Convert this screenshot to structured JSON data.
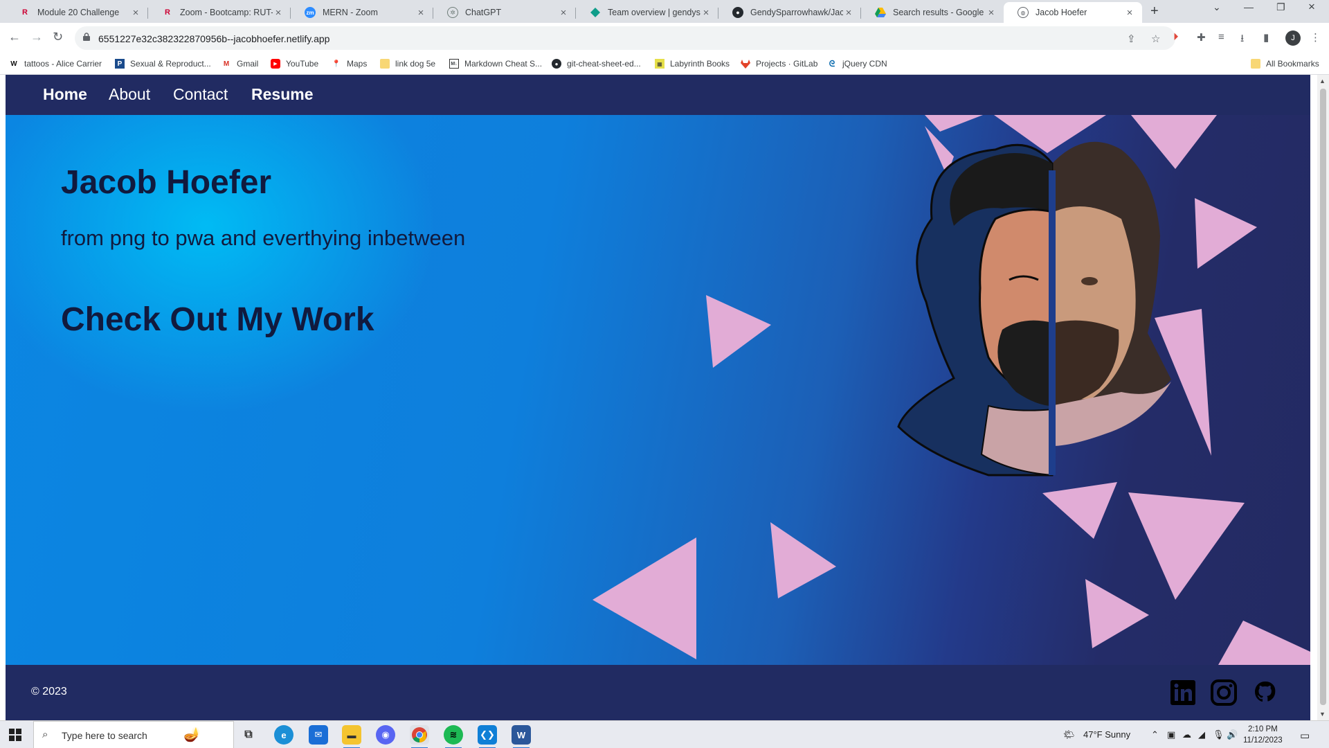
{
  "browser": {
    "tabs": [
      {
        "title": "Module 20 Challenge",
        "icon": "rutgers-r-icon"
      },
      {
        "title": "Zoom - Bootcamp: RUT-V",
        "icon": "rutgers-r-icon"
      },
      {
        "title": "MERN - Zoom",
        "icon": "zoom-icon"
      },
      {
        "title": "ChatGPT",
        "icon": "chatgpt-icon"
      },
      {
        "title": "Team overview | gendysp",
        "icon": "diamond-icon"
      },
      {
        "title": "GendySparrowhawk/Jacol",
        "icon": "github-icon"
      },
      {
        "title": "Search results - Google D",
        "icon": "google-drive-icon"
      },
      {
        "title": "Jacob Hoefer",
        "icon": "globe-icon",
        "active": true
      }
    ],
    "url": "6551227e32c382322870956b--jacobhoefer.netlify.app",
    "profile_initial": "J",
    "bookmarks": [
      {
        "label": "tattoos - Alice Carrier",
        "icon": "w-icon"
      },
      {
        "label": "Sexual & Reproduct...",
        "icon": "page-icon"
      },
      {
        "label": "Gmail",
        "icon": "gmail-icon"
      },
      {
        "label": "YouTube",
        "icon": "youtube-icon"
      },
      {
        "label": "Maps",
        "icon": "maps-icon"
      },
      {
        "label": "link dog 5e",
        "icon": "folder-icon"
      },
      {
        "label": "Markdown Cheat S...",
        "icon": "markdown-icon"
      },
      {
        "label": "git-cheat-sheet-ed...",
        "icon": "github-icon"
      },
      {
        "label": "Labyrinth Books",
        "icon": "labyrinth-icon"
      },
      {
        "label": "Projects · GitLab",
        "icon": "gitlab-icon"
      },
      {
        "label": "jQuery CDN",
        "icon": "jquery-icon"
      }
    ],
    "all_bookmarks": "All Bookmarks"
  },
  "site": {
    "nav": [
      "Home",
      "About",
      "Contact",
      "Resume"
    ],
    "hero": {
      "name": "Jacob Hoefer",
      "tagline": "from png to pwa and everthying inbetween",
      "cta": "Check Out My Work"
    },
    "footer": {
      "copyright": "© 2023",
      "social": [
        "linkedin-icon",
        "instagram-icon",
        "github-icon"
      ]
    },
    "colors": {
      "nav_bg": "#212b62",
      "hero_text": "#111a3e",
      "triangle": "#e2acd6"
    }
  },
  "taskbar": {
    "search_placeholder": "Type here to search",
    "weather": "47°F  Sunny",
    "time": "2:10 PM",
    "date": "11/12/2023",
    "apps": [
      "task-view-icon",
      "edge-icon",
      "mail-icon",
      "file-explorer-icon",
      "discord-icon",
      "chrome-icon",
      "spotify-icon",
      "vscode-icon",
      "word-icon"
    ]
  }
}
